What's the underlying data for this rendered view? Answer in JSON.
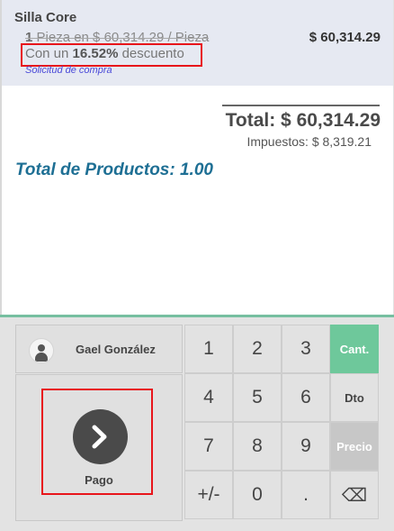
{
  "order_line": {
    "product_name": "Silla Core",
    "quantity": "1",
    "unit_info": " Pieza en $ 60,314.29 / Pieza",
    "price": "$ 60,314.29",
    "discount_prefix": "Con un ",
    "discount_value": "16.52%",
    "discount_suffix": " descuento",
    "purchase_link": "Solicitud de compra"
  },
  "summary": {
    "total": "Total: $ 60,314.29",
    "taxes": "Impuestos: $ 8,319.21",
    "total_products": "Total de Productos: 1.00"
  },
  "customer": {
    "name": "Gael González",
    "icon": "user-icon"
  },
  "payment": {
    "label": "Pago",
    "icon": "chevron-right-icon"
  },
  "numpad": {
    "rows": [
      [
        "1",
        "2",
        "3",
        "Cant."
      ],
      [
        "4",
        "5",
        "6",
        "Dto"
      ],
      [
        "7",
        "8",
        "9",
        "Precio"
      ],
      [
        "+/-",
        "0",
        ".",
        "⌫"
      ]
    ],
    "active_mode": "Cant.",
    "disabled_mode": "Precio",
    "colors": {
      "active": "#6ec89b",
      "disabled": "#c7c7c7",
      "accent_border": "#76bfa0"
    }
  }
}
